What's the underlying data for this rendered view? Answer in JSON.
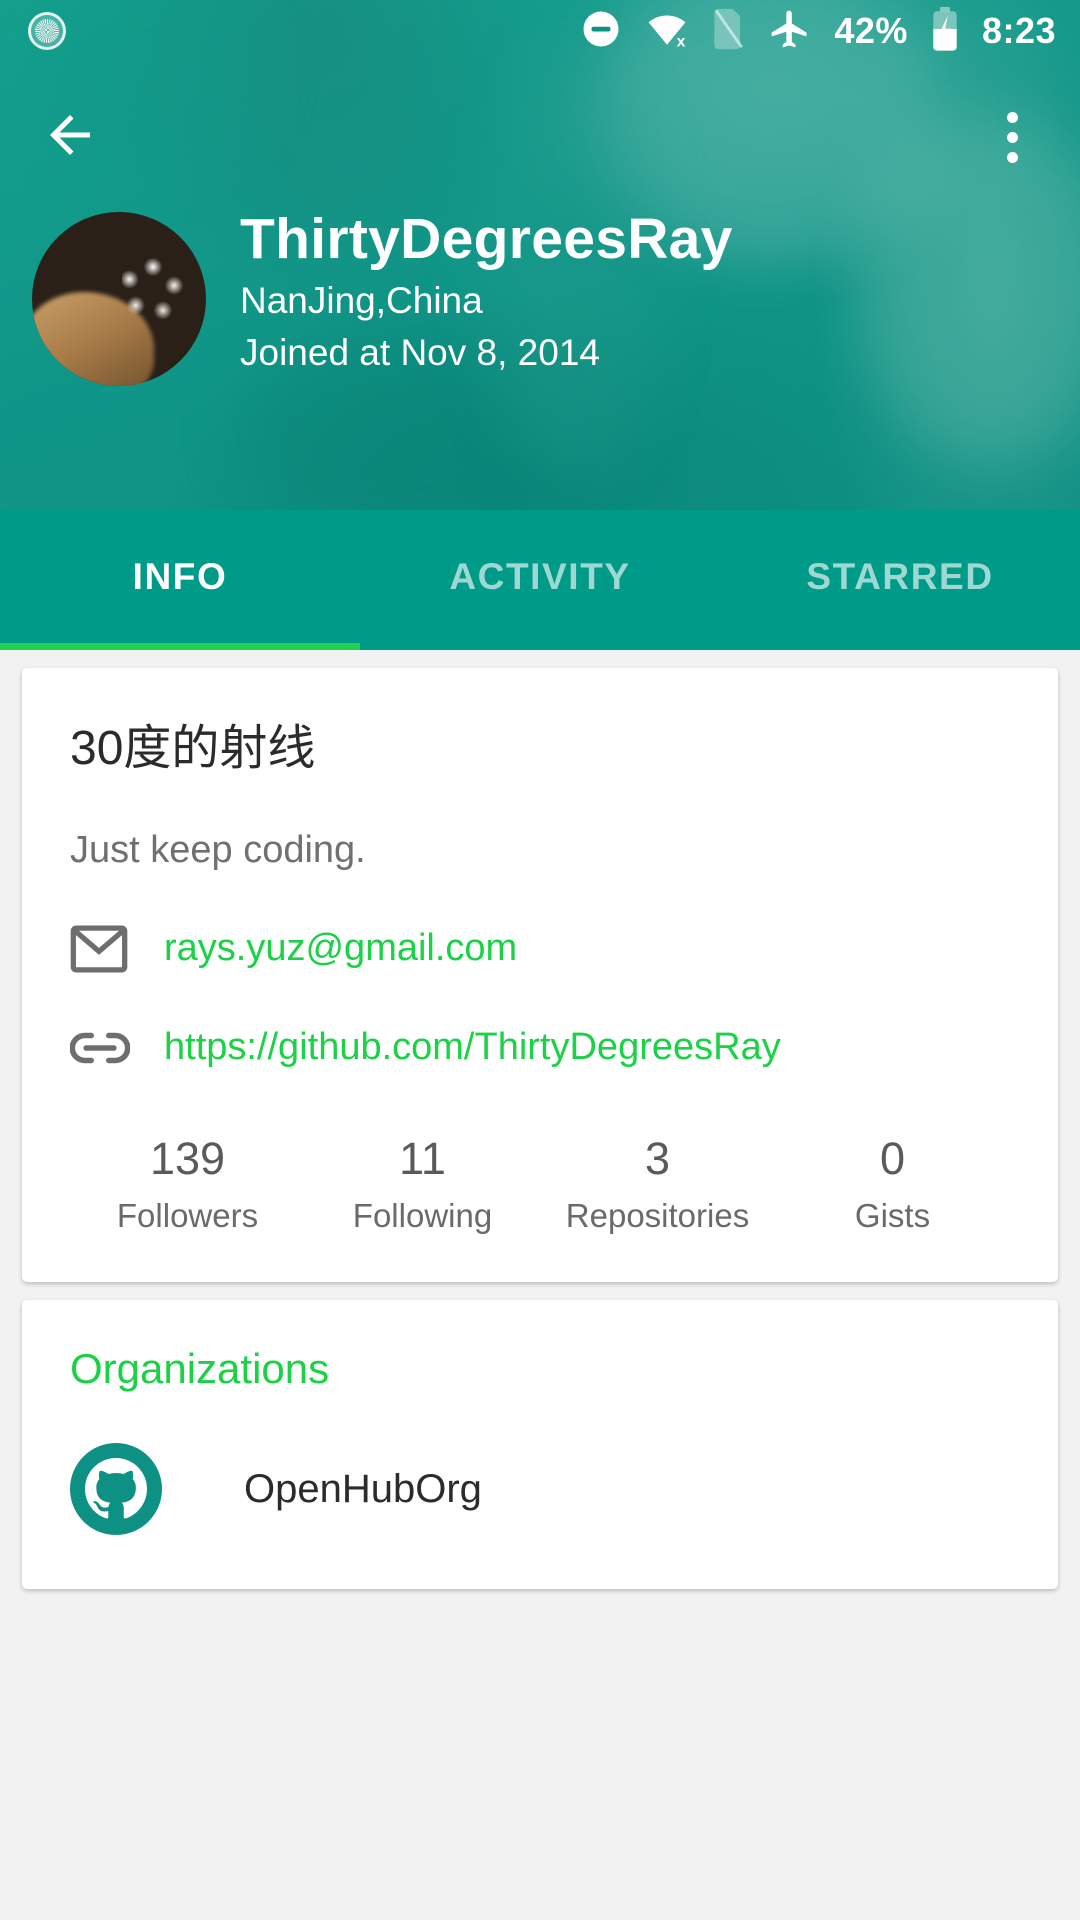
{
  "status_bar": {
    "notification_icon": "circular-notification-icon",
    "dnd_icon": "do-not-disturb-icon",
    "wifi_off_icon": "wifi-off-icon",
    "sim_off_icon": "sim-card-off-icon",
    "airplane_icon": "airplane-mode-icon",
    "battery_percent": "42%",
    "battery_icon": "battery-charging-icon",
    "clock": "8:23"
  },
  "app_bar": {
    "back_icon": "back-arrow-icon",
    "overflow_icon": "overflow-menu-icon"
  },
  "profile": {
    "avatar_alt": "user-avatar",
    "username": "ThirtyDegreesRay",
    "location": "NanJing,China",
    "joined": "Joined at Nov 8, 2014"
  },
  "tabs": [
    {
      "label": "INFO",
      "active": true
    },
    {
      "label": "ACTIVITY",
      "active": false
    },
    {
      "label": "STARRED",
      "active": false
    }
  ],
  "info_card": {
    "display_name": "30度的射线",
    "bio": "Just keep coding.",
    "email": {
      "icon": "mail-icon",
      "value": "rays.yuz@gmail.com"
    },
    "blog": {
      "icon": "link-icon",
      "value": "https://github.com/ThirtyDegreesRay"
    },
    "stats": [
      {
        "value": "139",
        "label": "Followers"
      },
      {
        "value": "11",
        "label": "Following"
      },
      {
        "value": "3",
        "label": "Repositories"
      },
      {
        "value": "0",
        "label": "Gists"
      }
    ]
  },
  "organizations_card": {
    "title": "Organizations",
    "items": [
      {
        "name": "OpenHubOrg",
        "icon": "github-octocat-icon"
      }
    ]
  },
  "colors": {
    "primary_teal": "#009a88",
    "header_teal": "#12998a",
    "accent_green": "#1bd145",
    "tab_indicator_green": "#1fd14f",
    "page_background": "#f2f2f2",
    "card_background": "#ffffff"
  }
}
